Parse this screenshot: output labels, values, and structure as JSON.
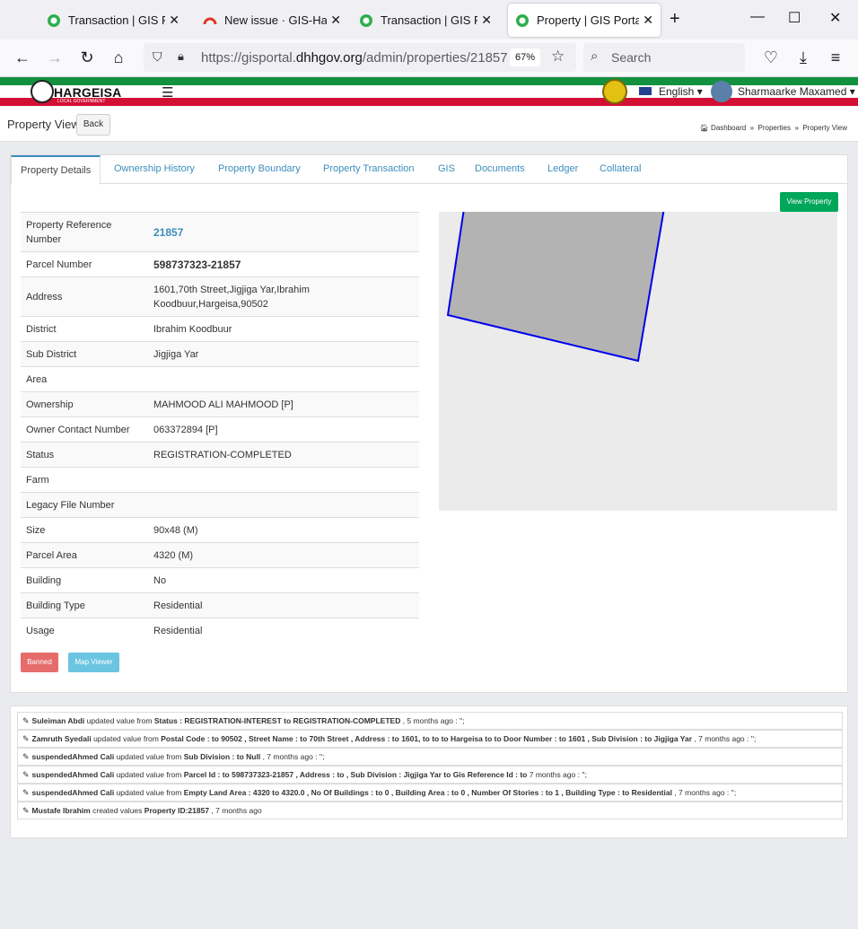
{
  "browser": {
    "tabs": [
      {
        "title": "Transaction | GIS Portal",
        "icon": "gis-favicon",
        "active": false
      },
      {
        "title": "New issue · GIS-Hargeisa",
        "icon": "gitlab-favicon",
        "active": false
      },
      {
        "title": "Transaction | GIS Portal",
        "icon": "gis-favicon",
        "active": false
      },
      {
        "title": "Property | GIS Portal",
        "icon": "gis-favicon",
        "active": true
      }
    ],
    "url_prefix": "https://gisportal.",
    "url_domain": "dhhgov.org",
    "url_path": "/admin/properties/21857",
    "zoom": "67%",
    "search_placeholder": "Search"
  },
  "site": {
    "logo_text": "HARGEISA",
    "logo_sub": "LOCAL GOVERNMENT",
    "language": "English",
    "user_name": "Sharmaarke Maxamed",
    "colors": {
      "green": "#149041",
      "red": "#d21034",
      "primary": "#3c8dbc",
      "success": "#00a65a"
    }
  },
  "page": {
    "title": "Property View",
    "back_label": "Back",
    "breadcrumb": [
      "Dashboard",
      "Properties",
      "Property View"
    ]
  },
  "tabs": [
    "Property Details",
    "Ownership History",
    "Property Boundary",
    "Property Transaction",
    "GIS",
    "Documents",
    "Ledger",
    "Collateral"
  ],
  "view_property_label": "View Property",
  "details": [
    {
      "label": "Property Reference Number",
      "value": "21857"
    },
    {
      "label": "Parcel Number",
      "value": "598737323-21857"
    },
    {
      "label": "Address",
      "value": "1601,70th Street,Jigjiga Yar,Ibrahim Koodbuur,Hargeisa,90502"
    },
    {
      "label": "District",
      "value": "Ibrahim Koodbuur"
    },
    {
      "label": "Sub District",
      "value": "Jigjiga Yar"
    },
    {
      "label": "Area",
      "value": ""
    },
    {
      "label": "Ownership",
      "value": "MAHMOOD ALI MAHMOOD [P]"
    },
    {
      "label": "Owner Contact Number",
      "value": "063372894 [P]"
    },
    {
      "label": "Status",
      "value": "REGISTRATION-COMPLETED"
    },
    {
      "label": "Farm",
      "value": ""
    },
    {
      "label": "Legacy File Number",
      "value": ""
    },
    {
      "label": "Size",
      "value": "90x48 (M)"
    },
    {
      "label": "Parcel Area",
      "value": "4320 (M)"
    },
    {
      "label": "Building",
      "value": "No"
    },
    {
      "label": "Building Type",
      "value": "Residential"
    },
    {
      "label": "Usage",
      "value": "Residential"
    }
  ],
  "actions": {
    "banned": "Banned",
    "map_viewer": "Map Viewer"
  },
  "activity": [
    {
      "user": "Suleiman Abdi",
      "verb": "updated value from",
      "detail": "Status : REGISTRATION-INTEREST to REGISTRATION-COMPLETED",
      "time": ", 5 months ago : '';"
    },
    {
      "user": "Zamruth Syedali",
      "verb": "updated value from",
      "detail": "Postal Code : to 90502 , Street Name : to 70th Street , Address : to 1601, to to to Hargeisa to to Door Number : to 1601 , Sub Division : to Jigjiga Yar",
      "time": ", 7 months ago : '';"
    },
    {
      "user": "suspendedAhmed Cali",
      "verb": "updated value from",
      "detail": "Sub Division : to Null",
      "time": ", 7 months ago : '';"
    },
    {
      "user": "suspendedAhmed Cali",
      "verb": "updated value from",
      "detail": "Parcel Id : to 598737323-21857 , Address : to , Sub Division : Jigjiga Yar to Gis Reference Id : to",
      "time": "7 months ago : '';"
    },
    {
      "user": "suspendedAhmed Cali",
      "verb": "updated value from",
      "detail": "Empty Land Area : 4320 to 4320.0 , No Of Buildings : to 0 , Building Area : to 0 , Number Of Stories : to 1 , Building Type : to Residential",
      "time": ", 7 months ago : '';"
    },
    {
      "user": "Mustafe Ibrahim",
      "verb": "created values",
      "detail": "Property ID:21857",
      "time": ", 7 months ago"
    }
  ]
}
